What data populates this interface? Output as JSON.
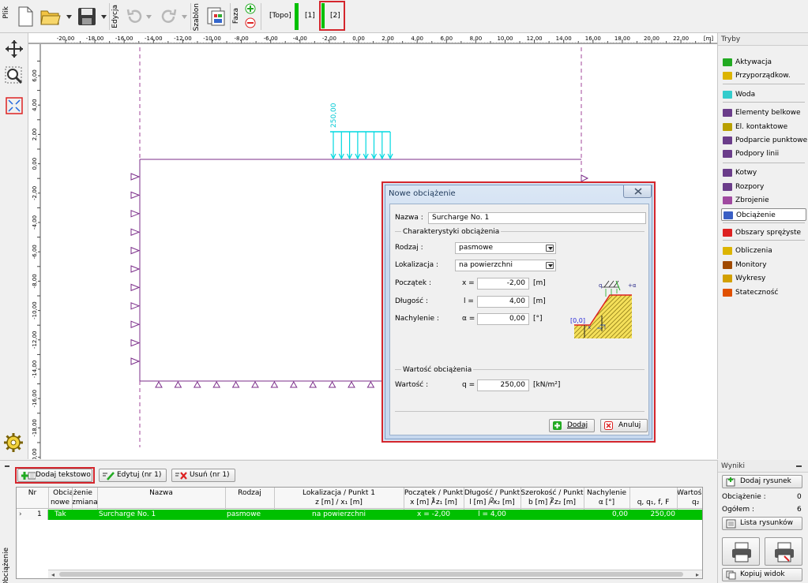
{
  "toolbar": {
    "file_label": "Plik",
    "edit_label": "Edycja",
    "template_label": "Szablon",
    "phase_label": "Faza",
    "phases": [
      "[Topo]",
      "[1]",
      "[2]"
    ]
  },
  "ruler": {
    "unit": "[m]",
    "x_ticks": [
      "-20,00",
      "-18,00",
      "-16,00",
      "-14,00",
      "-12,00",
      "-10,00",
      "-8,00",
      "-6,00",
      "-4,00",
      "-2,00",
      "0,00",
      "2,00",
      "4,00",
      "6,00",
      "8,00",
      "10,00",
      "12,00",
      "14,00",
      "16,00",
      "18,00",
      "20,00",
      "22,00"
    ],
    "y_ticks": [
      "6,00",
      "4,00",
      "2,00",
      "0,00",
      "-2,00",
      "-4,00",
      "-6,00",
      "-8,00",
      "-10,00",
      "-12,00",
      "-14,00",
      "-16,00",
      "-18,00",
      "-20,00"
    ]
  },
  "canvas": {
    "load_label": "250,00"
  },
  "modes": {
    "header": "Tryby",
    "items": [
      {
        "label": "Aktywacja",
        "icon": "activation-icon"
      },
      {
        "label": "Przyporządkow.",
        "icon": "assign-icon"
      },
      {
        "label": "Woda",
        "icon": "water-icon"
      },
      {
        "label": "Elementy belkowe",
        "icon": "beam-icon"
      },
      {
        "label": "El. kontaktowe",
        "icon": "contact-icon"
      },
      {
        "label": "Podparcie punktowe",
        "icon": "point-support-icon"
      },
      {
        "label": "Podpory linii",
        "icon": "line-support-icon"
      },
      {
        "label": "Kotwy",
        "icon": "anchor-icon"
      },
      {
        "label": "Rozpory",
        "icon": "strut-icon"
      },
      {
        "label": "Zbrojenie",
        "icon": "reinforcement-icon"
      },
      {
        "label": "Obciążenie",
        "icon": "load-icon"
      },
      {
        "label": "Obszary sprężyste",
        "icon": "elastic-icon"
      },
      {
        "label": "Obliczenia",
        "icon": "calc-icon"
      },
      {
        "label": "Monitory",
        "icon": "monitor-icon"
      },
      {
        "label": "Wykresy",
        "icon": "graph-icon"
      },
      {
        "label": "Stateczność",
        "icon": "stability-icon"
      }
    ],
    "selected": "Obciążenie"
  },
  "dialog": {
    "title": "Nowe obciążenie",
    "name_label": "Nazwa :",
    "name_value": "Surcharge No. 1",
    "group1": "Charakterystyki obciążenia",
    "type_label": "Rodzaj :",
    "type_value": "pasmowe",
    "location_label": "Lokalizacja :",
    "location_value": "na powierzchni",
    "start_label": "Początek :",
    "start_var": "x =",
    "start_value": "-2,00",
    "start_unit": "[m]",
    "length_label": "Długość :",
    "length_var": "l =",
    "length_value": "4,00",
    "length_unit": "[m]",
    "incl_label": "Nachylenie :",
    "incl_var": "α =",
    "incl_value": "0,00",
    "incl_unit": "[°]",
    "group2": "Wartość obciążenia",
    "value_label": "Wartość :",
    "value_var": "q =",
    "value_value": "250,00",
    "value_unit": "[kN/m²]",
    "add_button": "Dodaj",
    "cancel_button": "Anuluj",
    "sketch_q": "q",
    "sketch_alpha": "+α",
    "sketch_origin": "[0,0]",
    "sketch_x": "x",
    "sketch_l": "l"
  },
  "bottom": {
    "side_label": "Obciążenie",
    "add_text_button": "Dodaj tekstowo",
    "edit_button": "Edytuj (nr 1)",
    "delete_button": "Usuń (nr 1)",
    "headers": {
      "nr": "Nr",
      "load": "Obciążenie",
      "new": "nowe",
      "change": "zmiana",
      "name": "Nazwa",
      "type": "Rodzaj",
      "loc1": "Lokalizacja / Punkt 1",
      "loc2": "z [m] / x₁ [m]",
      "start1": "Początek / Punkt 1",
      "start2": "x [m] / z₁ [m]",
      "len1": "Długość / Punkt 2",
      "len2": "l [m] / x₂ [m]",
      "width1": "Szerokość / Punkt 2",
      "width2": "b [m] / z₂ [m]",
      "incl1": "Nachylenie",
      "incl2": "α [°]",
      "val1": "Wartoś",
      "val2": "q, q₁, f, F",
      "val3": "q₂"
    },
    "row": {
      "nr": "1",
      "new": "Tak",
      "name": "Surcharge No. 1",
      "type": "pasmowe",
      "location": "na powierzchni",
      "start": "x = -2,00",
      "length": "l = 4,00",
      "incl": "0,00",
      "value": "250,00"
    }
  },
  "results": {
    "header": "Wyniki",
    "add_drawing": "Dodaj rysunek",
    "load_label": "Obciążenie :",
    "load_count": "0",
    "total_label": "Ogółem :",
    "total_count": "6",
    "list_button": "Lista rysunków",
    "copy_button": "Kopiuj widok"
  },
  "colors": {
    "accent_green": "#00c000",
    "selection_red": "#d4262d",
    "load_cyan": "#00d8e0",
    "geometry_purple": "#7b2d8a"
  }
}
